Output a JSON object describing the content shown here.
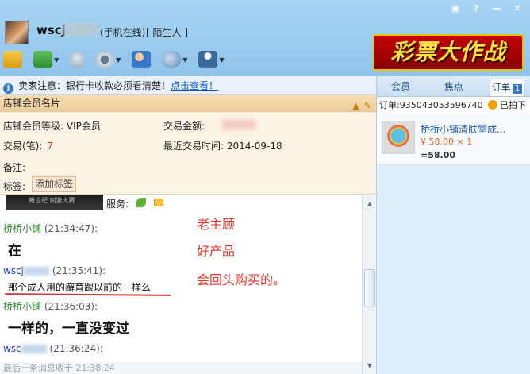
{
  "header": {
    "user_name": "wscjr",
    "status": "(手机在线)",
    "relation_open": "[",
    "relation": "陌生人",
    "relation_close": "]",
    "window_buttons": [
      "▣",
      "?",
      "—",
      "✕"
    ],
    "toolbar_icons": [
      "transfer-icon",
      "file-icon",
      "mic-icon",
      "camera-icon",
      "user-add-icon",
      "globe-icon",
      "app-icon"
    ]
  },
  "banner": {
    "text": "彩票大作战"
  },
  "notice": {
    "prefix": "卖家注意：银行卡收款必须看清楚！",
    "link": "点击查看！"
  },
  "member_card": {
    "title": "店铺会员名片",
    "member_level_label": "店铺会员等级:",
    "member_level_value": "VIP会员",
    "trade_amount_label": "交易金额:",
    "trade_count_label": "交易(笔):",
    "trade_count_value": "7",
    "last_trade_label": "最近交易时间:",
    "last_trade_value": "2014-09-18",
    "note_label": "备注:",
    "tag_label": "标签:",
    "add_tag_button": "添加标签"
  },
  "chat": {
    "service_label": "服务:",
    "strip_text": "新世纪 刺激大赛",
    "messages": [
      {
        "sender": "桥桥小铺",
        "time": "(21:34:47):",
        "text": "在"
      },
      {
        "sender": "wscj",
        "time": "(21:35:41):",
        "text": "那个成人用的癣育跟以前的一样么"
      },
      {
        "sender": "桥桥小铺",
        "time": "(21:36:03):",
        "text": "一样的，一直没变过"
      },
      {
        "sender": "wsc",
        "time": "(21:36:24):",
        "text": ""
      }
    ],
    "annotations": [
      "老主顾",
      "好产品",
      "会回头购买的。"
    ],
    "last_message": "最后一条消息收于 21:38:24"
  },
  "right_panel": {
    "tabs": [
      {
        "label": "会员",
        "active": false
      },
      {
        "label": "焦点",
        "active": false
      },
      {
        "label": "订单",
        "active": true,
        "count": "1"
      }
    ],
    "order_id": "订单:935043053596740",
    "order_status": "已拍下",
    "item": {
      "title": "桥桥小铺清肤堂成...",
      "price": "¥ 58.00 × 1",
      "total": "=58.00"
    }
  }
}
